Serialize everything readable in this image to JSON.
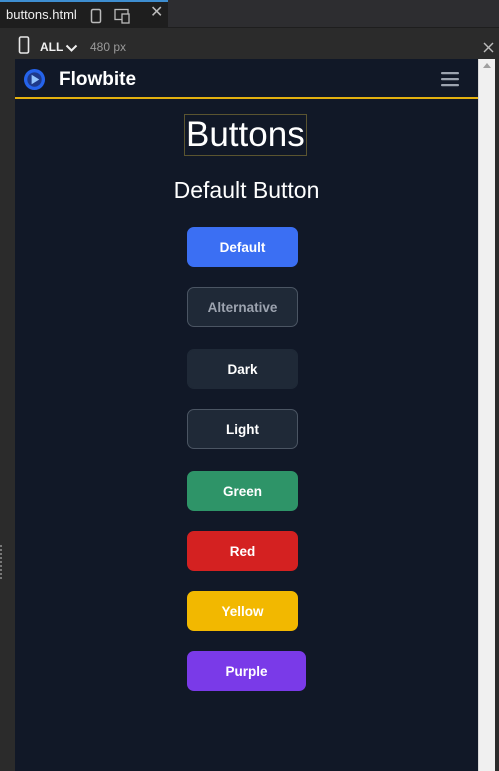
{
  "editor": {
    "tab_title": "buttons.html",
    "media_query": "ALL",
    "viewport_width": "480 px"
  },
  "navbar": {
    "brand": "Flowbite"
  },
  "page": {
    "heading": "Buttons",
    "subheading": "Default Button"
  },
  "buttons": [
    {
      "label": "Default",
      "bg": "#3b6ff3",
      "text": "#ffffff",
      "border": "#3b6ff3"
    },
    {
      "label": "Alternative",
      "bg": "#1f2937",
      "text": "#9ca3af",
      "border": "#4b5563"
    },
    {
      "label": "Dark",
      "bg": "#1f2937",
      "text": "#ffffff",
      "border": "#1f2937"
    },
    {
      "label": "Light",
      "bg": "#1f2937",
      "text": "#ffffff",
      "border": "#4b5563"
    },
    {
      "label": "Green",
      "bg": "#2e9468",
      "text": "#ffffff",
      "border": "#2e9468"
    },
    {
      "label": "Red",
      "bg": "#d42121",
      "text": "#ffffff",
      "border": "#d42121"
    },
    {
      "label": "Yellow",
      "bg": "#f2b800",
      "text": "#ffffff",
      "border": "#f2b800"
    },
    {
      "label": "Purple",
      "bg": "#7a3ae8",
      "text": "#ffffff",
      "border": "#7a3ae8"
    }
  ],
  "colors": {
    "page_bg": "#111827",
    "navbar_accent": "#e3b00f"
  }
}
